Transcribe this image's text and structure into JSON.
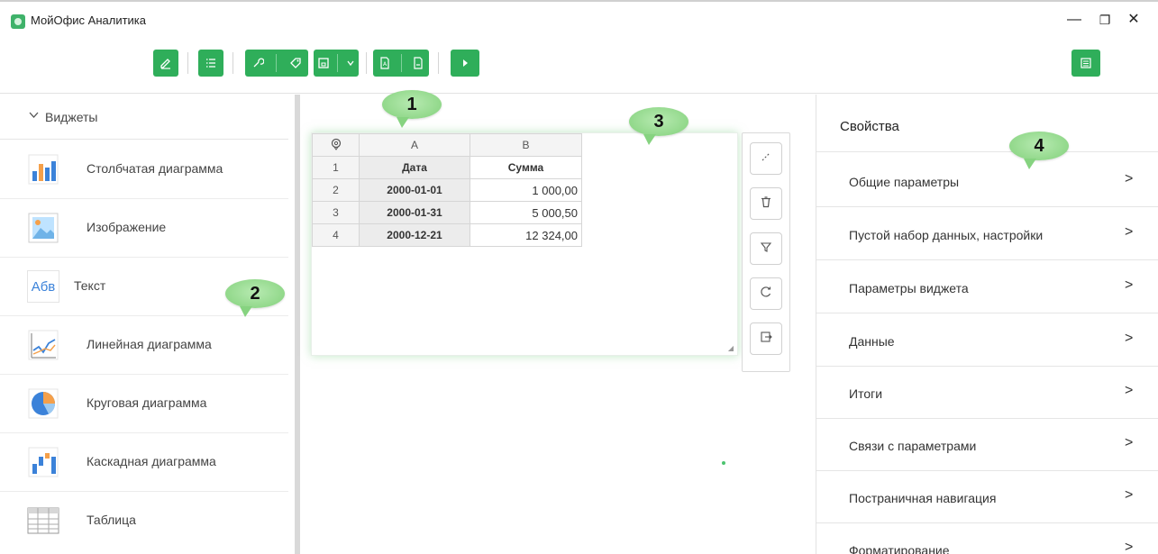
{
  "window": {
    "title": "МойОфис Аналитика",
    "controls": {
      "minimize": "—",
      "restore": "❐",
      "close": "✕"
    }
  },
  "toolbar": {
    "buttons": [
      {
        "name": "edit-button",
        "icon": "pencil-icon"
      },
      {
        "name": "list-button",
        "icon": "list-icon"
      },
      {
        "name": "settings-button",
        "icon": "wrench-icon"
      },
      {
        "name": "tag-button",
        "icon": "tag-icon"
      },
      {
        "name": "save-button",
        "icon": "save-icon"
      },
      {
        "name": "save-dropdown-button",
        "icon": "chevron-down-icon"
      },
      {
        "name": "export-pdf-button",
        "icon": "pdf-file-icon"
      },
      {
        "name": "export-file-button",
        "icon": "file-export-icon"
      },
      {
        "name": "run-button",
        "icon": "play-icon"
      },
      {
        "name": "panel-toggle-button",
        "icon": "panel-icon"
      }
    ],
    "accent": "#2fae5a"
  },
  "callouts": [
    "1",
    "2",
    "3",
    "4"
  ],
  "widgets_panel": {
    "header": "Виджеты",
    "items": [
      {
        "label": "Столбчатая диаграмма",
        "icon": "bar-chart-icon"
      },
      {
        "label": "Изображение",
        "icon": "image-icon"
      },
      {
        "label": "Текст",
        "icon": "text-icon",
        "glyph": "Абв"
      },
      {
        "label": "Линейная диаграмма",
        "icon": "line-chart-icon"
      },
      {
        "label": "Круговая диаграмма",
        "icon": "pie-chart-icon"
      },
      {
        "label": "Каскадная диаграмма",
        "icon": "waterfall-chart-icon"
      },
      {
        "label": "Таблица",
        "icon": "table-icon"
      }
    ]
  },
  "table_widget": {
    "corner_icon": "location-pin-icon",
    "columns": [
      "A",
      "B"
    ],
    "rows": [
      {
        "num": "1",
        "a": "Дата",
        "b": "Сумма"
      },
      {
        "num": "2",
        "a": "2000-01-01",
        "b": "1 000,00"
      },
      {
        "num": "3",
        "a": "2000-01-31",
        "b": "5 000,50"
      },
      {
        "num": "4",
        "a": "2000-12-21",
        "b": "12 324,00"
      }
    ],
    "tools": [
      "expand-icon",
      "trash-icon",
      "filter-icon",
      "refresh-icon",
      "export-icon"
    ]
  },
  "properties_panel": {
    "header": "Свойства",
    "rows": [
      "Общие параметры",
      "Пустой набор данных, настройки",
      "Параметры виджета",
      "Данные",
      "Итоги",
      "Связи с параметрами",
      "Постраничная навигация",
      "Форматирование"
    ],
    "arrow": ">"
  }
}
